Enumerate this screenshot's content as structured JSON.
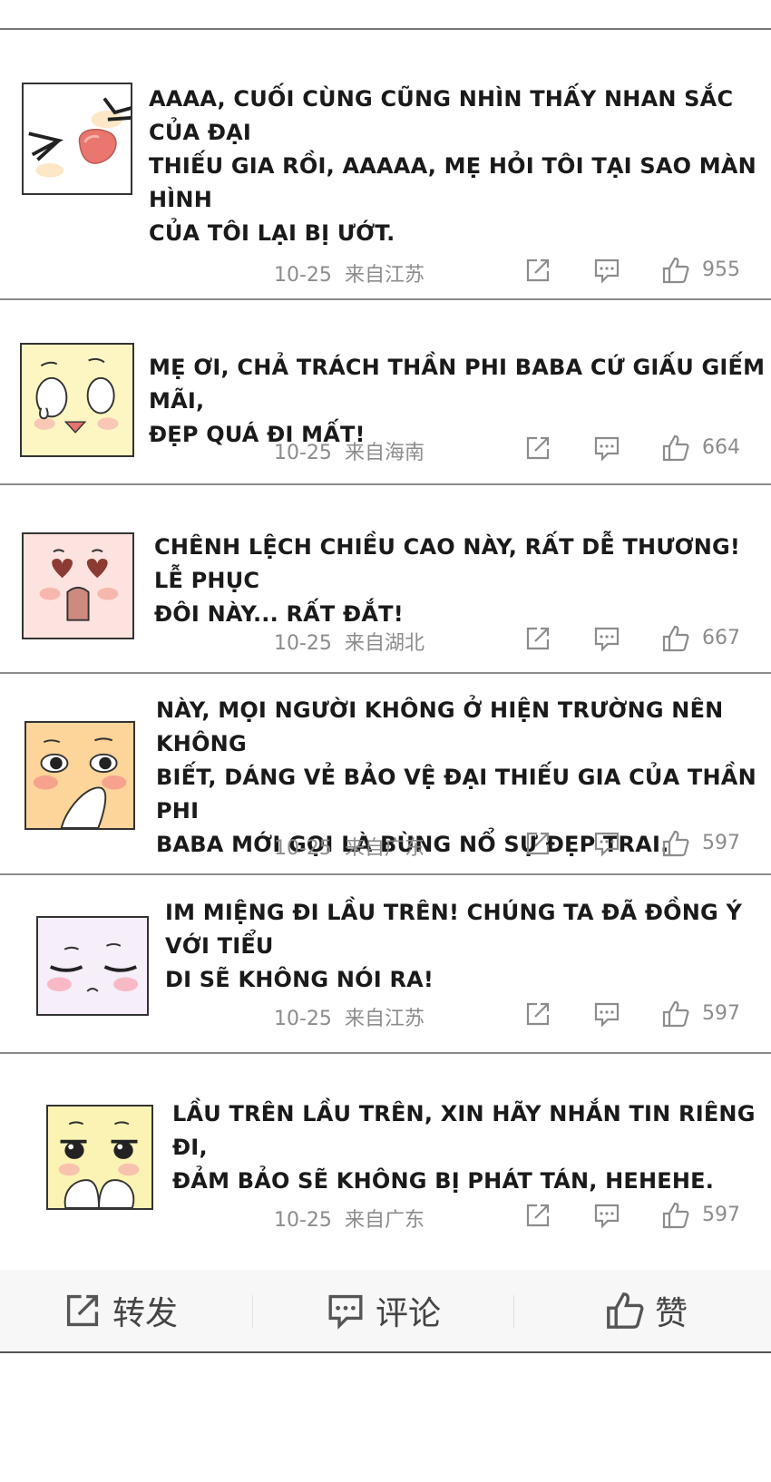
{
  "comments": [
    {
      "text_lines": [
        "AAAA, CUỐI CÙNG CŨNG NHÌN THẤY NHAN SẮC CỦA ĐẠI",
        "THIẾU GIA RỒI, AAAAA, MẸ HỎI TÔI TẠI SAO MÀN HÌNH",
        "CỦA TÔI LẠI BỊ ƯỚT."
      ],
      "date": "10-25",
      "location": "来自江苏",
      "likes": "955",
      "avatar_icon": "blush-kiss-avatar-icon",
      "avatar_bg": "#ffffff"
    },
    {
      "text_lines": [
        "MẸ ƠI, CHẢ TRÁCH THẦN PHI BABA CỨ GIẤU GIẾM MÃI,",
        "ĐẸP QUÁ ĐI MẤT!"
      ],
      "date": "10-25",
      "location": "来自海南",
      "likes": "664",
      "avatar_icon": "teary-face-avatar-icon",
      "avatar_bg": "#fdf6c2"
    },
    {
      "text_lines": [
        "CHÊNH LỆCH CHIỀU CAO NÀY, RẤT DỄ THƯƠNG! LỄ PHỤC",
        "ĐÔI NÀY... RẤT ĐẮT!"
      ],
      "date": "10-25",
      "location": "来自湖北",
      "likes": "667",
      "avatar_icon": "heart-eyes-avatar-icon",
      "avatar_bg": "#fde3df"
    },
    {
      "text_lines": [
        "NÀY, MỌI NGƯỜI KHÔNG Ở HIỆN TRƯỜNG NÊN KHÔNG",
        "BIẾT, DÁNG VẺ BẢO VỆ ĐẠI THIẾU GIA CỦA THẦN PHI",
        "BABA MỚI GỌI LÀ BÙNG NỔ SỰ ĐẸP TRAI."
      ],
      "date": "10-25",
      "location": "来自广东",
      "likes": "597",
      "avatar_icon": "shocked-face-avatar-icon",
      "avatar_bg": "#fdd49a"
    },
    {
      "text_lines": [
        "IM MIỆNG ĐI LẦU TRÊN! CHÚNG TA ĐÃ ĐỒNG Ý VỚI TIỂU",
        "DI SẼ KHÔNG NÓI RA!"
      ],
      "date": "10-25",
      "location": "来自江苏",
      "likes": "597",
      "avatar_icon": "content-face-avatar-icon",
      "avatar_bg": "#f6eef9"
    },
    {
      "text_lines": [
        "LẦU TRÊN LẦU TRÊN, XIN HÃY NHẮN TIN RIÊNG ĐI,",
        "ĐẢM BẢO SẼ KHÔNG BỊ PHÁT TÁN, HEHEHE."
      ],
      "date": "10-25",
      "location": "来自广东",
      "likes": "597",
      "avatar_icon": "pleading-hands-avatar-icon",
      "avatar_bg": "#fbf3b4"
    }
  ],
  "action_icons": {
    "share": "share-icon",
    "reply": "comment-icon",
    "like": "thumbs-up-icon"
  },
  "bottom_bar": {
    "share_label": "转发",
    "comment_label": "评论",
    "like_label": "赞"
  },
  "colors": {
    "meta_text": "#8c8c8c",
    "divider": "#8a8a8a",
    "icon": "#8c8c8c"
  }
}
